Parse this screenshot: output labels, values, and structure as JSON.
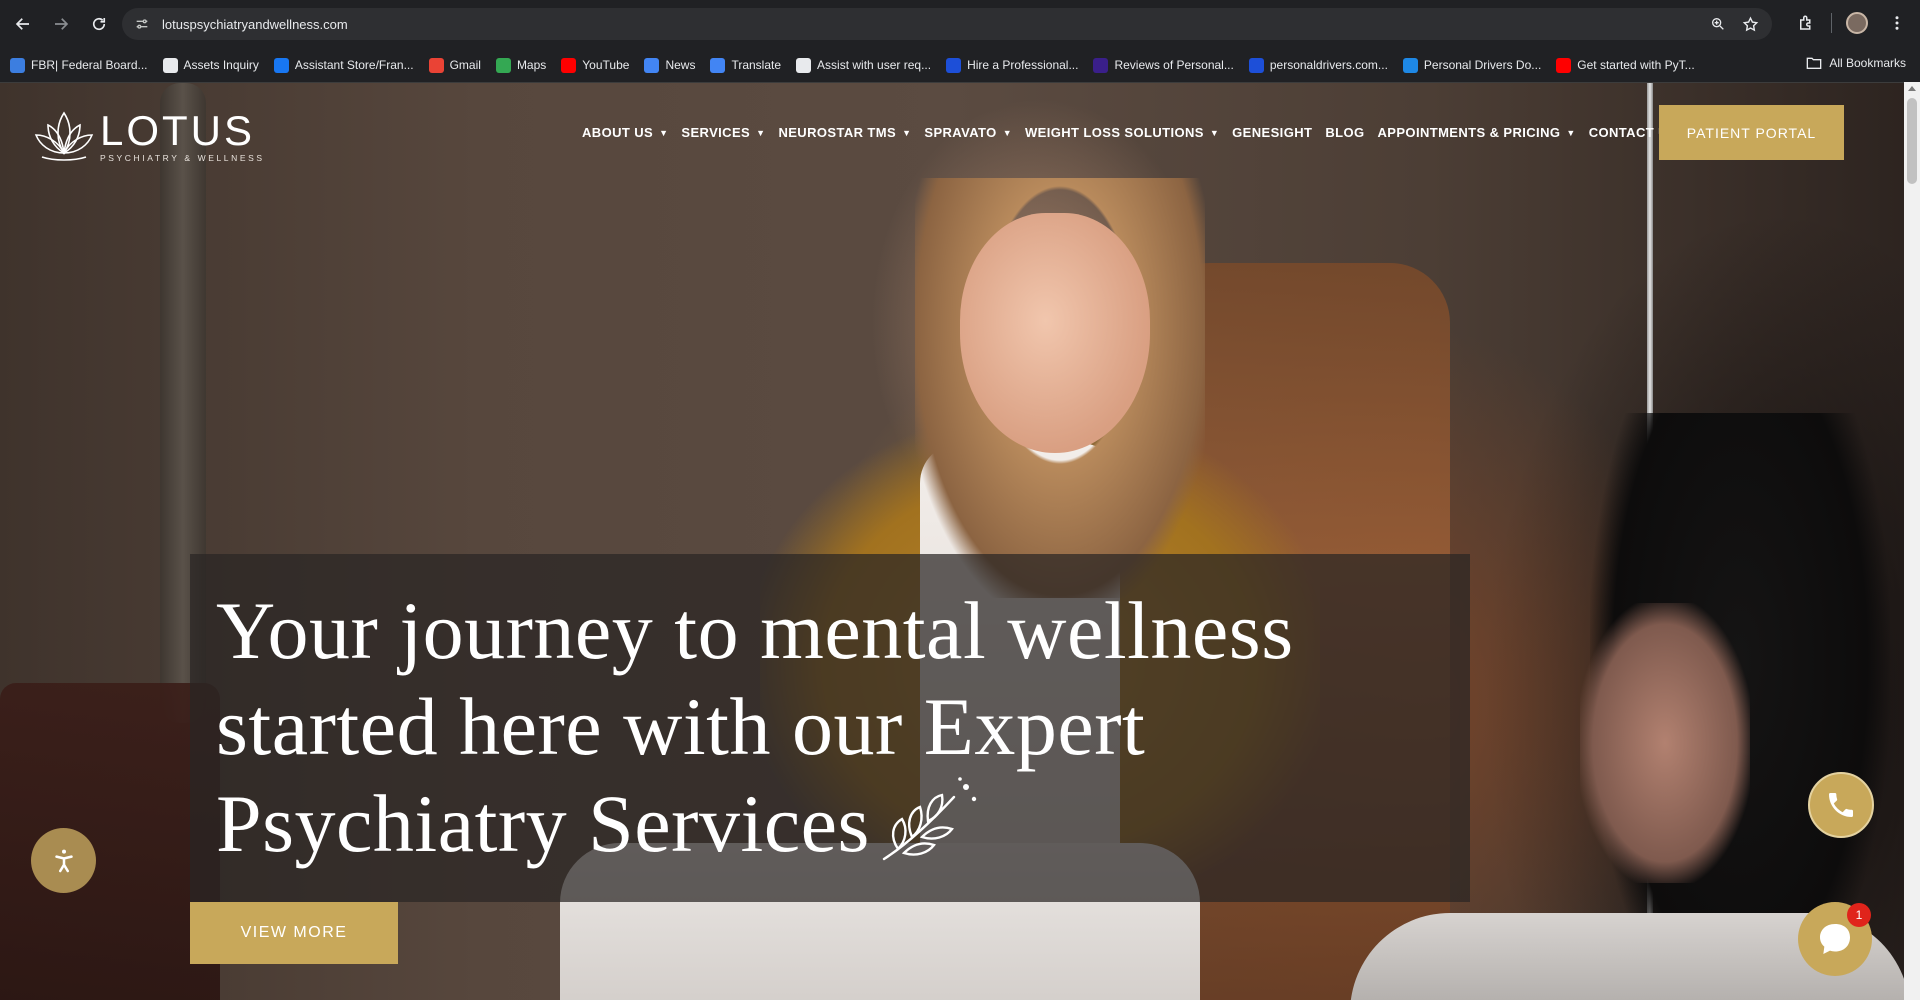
{
  "browser": {
    "url": "lotuspsychiatryandwellness.com",
    "bookmarks": [
      {
        "label": "FBR| Federal Board...",
        "icon": "document-icon",
        "color": "#3c7ee0"
      },
      {
        "label": "Assets Inquiry",
        "icon": "globe-icon",
        "color": "#e8eaed"
      },
      {
        "label": "Assistant Store/Fran...",
        "icon": "facebook-icon",
        "color": "#1877f2"
      },
      {
        "label": "Gmail",
        "icon": "gmail-icon",
        "color": "#ea4335"
      },
      {
        "label": "Maps",
        "icon": "maps-icon",
        "color": "#34a853"
      },
      {
        "label": "YouTube",
        "icon": "youtube-icon",
        "color": "#ff0000"
      },
      {
        "label": "News",
        "icon": "news-icon",
        "color": "#4285f4"
      },
      {
        "label": "Translate",
        "icon": "translate-icon",
        "color": "#4285f4"
      },
      {
        "label": "Assist with user req...",
        "icon": "openai-icon",
        "color": "#e8eaed"
      },
      {
        "label": "Hire a Professional...",
        "icon": "globe-icon",
        "color": "#1d4fd8"
      },
      {
        "label": "Reviews of Personal...",
        "icon": "star-icon",
        "color": "#3a1f8a"
      },
      {
        "label": "personaldrivers.com...",
        "icon": "globe-icon",
        "color": "#1d4fd8"
      },
      {
        "label": "Personal Drivers Do...",
        "icon": "cloud-icon",
        "color": "#1e88e5"
      },
      {
        "label": "Get started with PyT...",
        "icon": "youtube-icon",
        "color": "#ff0000"
      }
    ],
    "all_bookmarks": "All Bookmarks"
  },
  "site": {
    "logo_name": "LOTUS",
    "logo_tag": "PSYCHIATRY & WELLNESS",
    "menu": [
      {
        "label": "ABOUT US",
        "caret": "▼"
      },
      {
        "label": "SERVICES",
        "caret": "▼"
      },
      {
        "label": "NEUROSTAR TMS",
        "caret": "▼"
      },
      {
        "label": "SPRAVATO",
        "caret": "▼"
      },
      {
        "label": "WEIGHT LOSS SOLUTIONS",
        "caret": "▼"
      },
      {
        "label": "GENESIGHT",
        "caret": ""
      },
      {
        "label": "BLOG",
        "caret": ""
      },
      {
        "label": "APPOINTMENTS & PRICING",
        "caret": "▼"
      },
      {
        "label": "CONTACT US",
        "caret": ""
      }
    ],
    "portal_button": "PATIENT PORTAL",
    "accent_color": "#c8a85a"
  },
  "hero": {
    "headline_lines": [
      "Your journey to mental wellness",
      "started here with our Expert",
      "Psychiatry Services"
    ],
    "cta": "VIEW MORE"
  },
  "widgets": {
    "chat_badge": "1"
  }
}
